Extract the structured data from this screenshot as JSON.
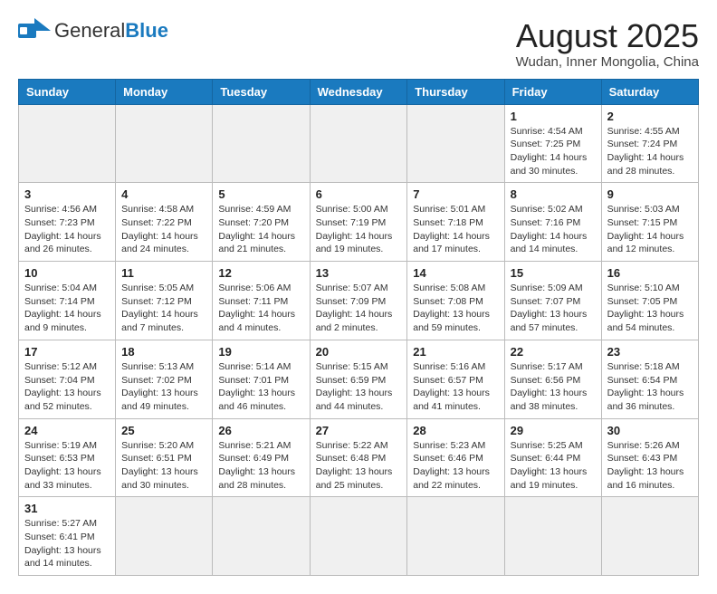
{
  "logo": {
    "general": "General",
    "blue": "Blue"
  },
  "header": {
    "title": "August 2025",
    "subtitle": "Wudan, Inner Mongolia, China"
  },
  "weekdays": [
    "Sunday",
    "Monday",
    "Tuesday",
    "Wednesday",
    "Thursday",
    "Friday",
    "Saturday"
  ],
  "weeks": [
    [
      {
        "day": "",
        "info": ""
      },
      {
        "day": "",
        "info": ""
      },
      {
        "day": "",
        "info": ""
      },
      {
        "day": "",
        "info": ""
      },
      {
        "day": "",
        "info": ""
      },
      {
        "day": "1",
        "info": "Sunrise: 4:54 AM\nSunset: 7:25 PM\nDaylight: 14 hours\nand 30 minutes."
      },
      {
        "day": "2",
        "info": "Sunrise: 4:55 AM\nSunset: 7:24 PM\nDaylight: 14 hours\nand 28 minutes."
      }
    ],
    [
      {
        "day": "3",
        "info": "Sunrise: 4:56 AM\nSunset: 7:23 PM\nDaylight: 14 hours\nand 26 minutes."
      },
      {
        "day": "4",
        "info": "Sunrise: 4:58 AM\nSunset: 7:22 PM\nDaylight: 14 hours\nand 24 minutes."
      },
      {
        "day": "5",
        "info": "Sunrise: 4:59 AM\nSunset: 7:20 PM\nDaylight: 14 hours\nand 21 minutes."
      },
      {
        "day": "6",
        "info": "Sunrise: 5:00 AM\nSunset: 7:19 PM\nDaylight: 14 hours\nand 19 minutes."
      },
      {
        "day": "7",
        "info": "Sunrise: 5:01 AM\nSunset: 7:18 PM\nDaylight: 14 hours\nand 17 minutes."
      },
      {
        "day": "8",
        "info": "Sunrise: 5:02 AM\nSunset: 7:16 PM\nDaylight: 14 hours\nand 14 minutes."
      },
      {
        "day": "9",
        "info": "Sunrise: 5:03 AM\nSunset: 7:15 PM\nDaylight: 14 hours\nand 12 minutes."
      }
    ],
    [
      {
        "day": "10",
        "info": "Sunrise: 5:04 AM\nSunset: 7:14 PM\nDaylight: 14 hours\nand 9 minutes."
      },
      {
        "day": "11",
        "info": "Sunrise: 5:05 AM\nSunset: 7:12 PM\nDaylight: 14 hours\nand 7 minutes."
      },
      {
        "day": "12",
        "info": "Sunrise: 5:06 AM\nSunset: 7:11 PM\nDaylight: 14 hours\nand 4 minutes."
      },
      {
        "day": "13",
        "info": "Sunrise: 5:07 AM\nSunset: 7:09 PM\nDaylight: 14 hours\nand 2 minutes."
      },
      {
        "day": "14",
        "info": "Sunrise: 5:08 AM\nSunset: 7:08 PM\nDaylight: 13 hours\nand 59 minutes."
      },
      {
        "day": "15",
        "info": "Sunrise: 5:09 AM\nSunset: 7:07 PM\nDaylight: 13 hours\nand 57 minutes."
      },
      {
        "day": "16",
        "info": "Sunrise: 5:10 AM\nSunset: 7:05 PM\nDaylight: 13 hours\nand 54 minutes."
      }
    ],
    [
      {
        "day": "17",
        "info": "Sunrise: 5:12 AM\nSunset: 7:04 PM\nDaylight: 13 hours\nand 52 minutes."
      },
      {
        "day": "18",
        "info": "Sunrise: 5:13 AM\nSunset: 7:02 PM\nDaylight: 13 hours\nand 49 minutes."
      },
      {
        "day": "19",
        "info": "Sunrise: 5:14 AM\nSunset: 7:01 PM\nDaylight: 13 hours\nand 46 minutes."
      },
      {
        "day": "20",
        "info": "Sunrise: 5:15 AM\nSunset: 6:59 PM\nDaylight: 13 hours\nand 44 minutes."
      },
      {
        "day": "21",
        "info": "Sunrise: 5:16 AM\nSunset: 6:57 PM\nDaylight: 13 hours\nand 41 minutes."
      },
      {
        "day": "22",
        "info": "Sunrise: 5:17 AM\nSunset: 6:56 PM\nDaylight: 13 hours\nand 38 minutes."
      },
      {
        "day": "23",
        "info": "Sunrise: 5:18 AM\nSunset: 6:54 PM\nDaylight: 13 hours\nand 36 minutes."
      }
    ],
    [
      {
        "day": "24",
        "info": "Sunrise: 5:19 AM\nSunset: 6:53 PM\nDaylight: 13 hours\nand 33 minutes."
      },
      {
        "day": "25",
        "info": "Sunrise: 5:20 AM\nSunset: 6:51 PM\nDaylight: 13 hours\nand 30 minutes."
      },
      {
        "day": "26",
        "info": "Sunrise: 5:21 AM\nSunset: 6:49 PM\nDaylight: 13 hours\nand 28 minutes."
      },
      {
        "day": "27",
        "info": "Sunrise: 5:22 AM\nSunset: 6:48 PM\nDaylight: 13 hours\nand 25 minutes."
      },
      {
        "day": "28",
        "info": "Sunrise: 5:23 AM\nSunset: 6:46 PM\nDaylight: 13 hours\nand 22 minutes."
      },
      {
        "day": "29",
        "info": "Sunrise: 5:25 AM\nSunset: 6:44 PM\nDaylight: 13 hours\nand 19 minutes."
      },
      {
        "day": "30",
        "info": "Sunrise: 5:26 AM\nSunset: 6:43 PM\nDaylight: 13 hours\nand 16 minutes."
      }
    ],
    [
      {
        "day": "31",
        "info": "Sunrise: 5:27 AM\nSunset: 6:41 PM\nDaylight: 13 hours\nand 14 minutes."
      },
      {
        "day": "",
        "info": ""
      },
      {
        "day": "",
        "info": ""
      },
      {
        "day": "",
        "info": ""
      },
      {
        "day": "",
        "info": ""
      },
      {
        "day": "",
        "info": ""
      },
      {
        "day": "",
        "info": ""
      }
    ]
  ]
}
